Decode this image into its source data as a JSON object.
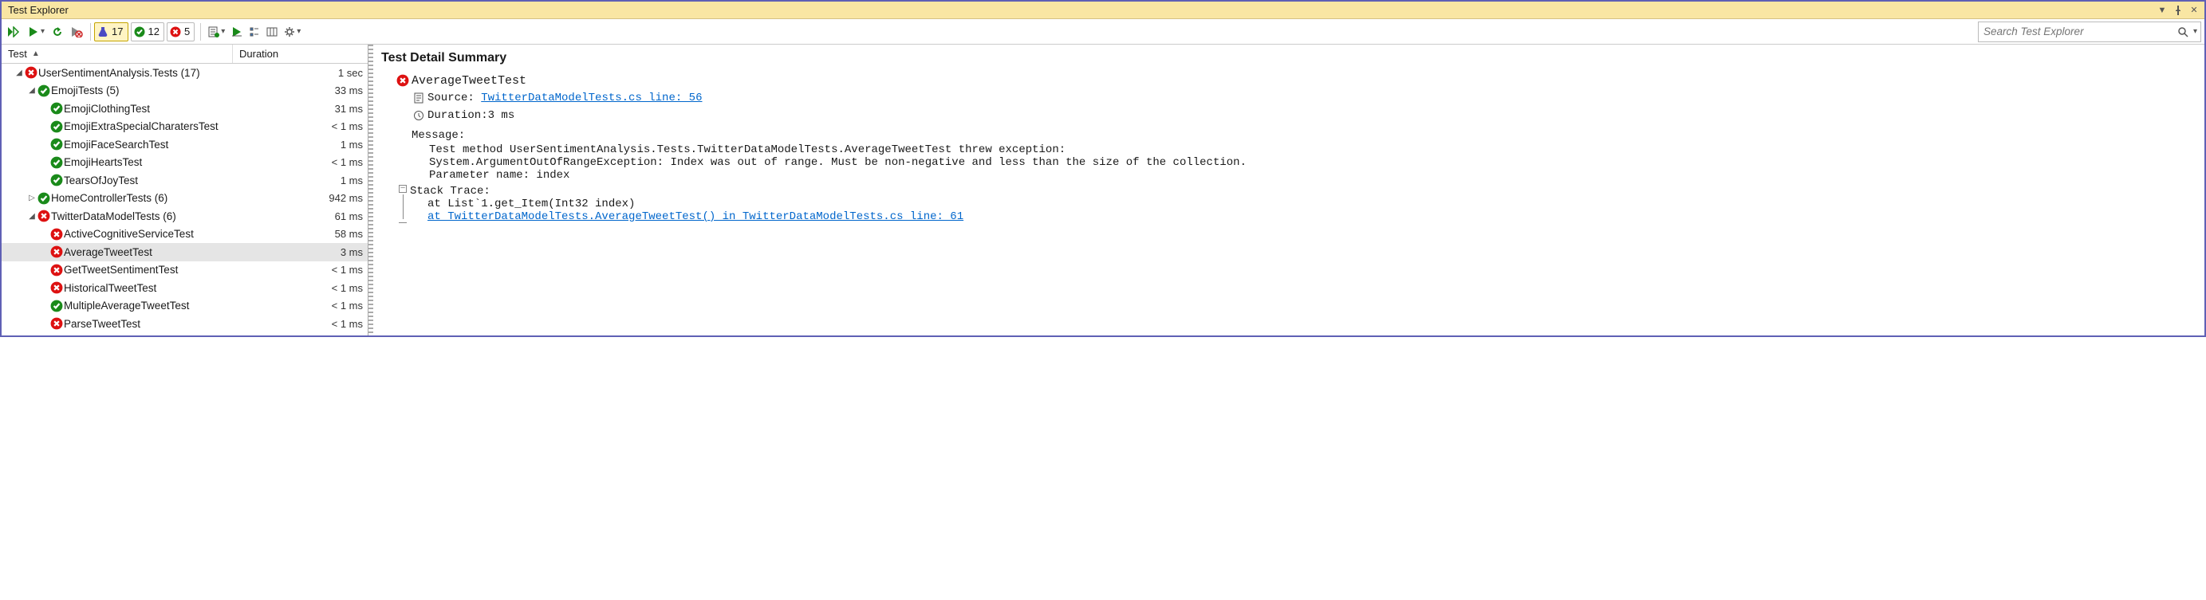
{
  "title": "Test Explorer",
  "search_placeholder": "Search Test Explorer",
  "filters": {
    "total": 17,
    "passed": 12,
    "failed": 5
  },
  "columns": {
    "test": "Test",
    "duration": "Duration"
  },
  "tree": [
    {
      "indent": 0,
      "glyph": "▲",
      "status": "fail",
      "name": "UserSentimentAnalysis.Tests  (17)",
      "duration": "1 sec"
    },
    {
      "indent": 1,
      "glyph": "▲",
      "status": "pass",
      "name": "EmojiTests  (5)",
      "duration": "33 ms"
    },
    {
      "indent": 2,
      "glyph": "",
      "status": "pass",
      "name": "EmojiClothingTest",
      "duration": "31 ms"
    },
    {
      "indent": 2,
      "glyph": "",
      "status": "pass",
      "name": "EmojiExtraSpecialCharatersTest",
      "duration": "< 1 ms"
    },
    {
      "indent": 2,
      "glyph": "",
      "status": "pass",
      "name": "EmojiFaceSearchTest",
      "duration": "1 ms"
    },
    {
      "indent": 2,
      "glyph": "",
      "status": "pass",
      "name": "EmojiHeartsTest",
      "duration": "< 1 ms"
    },
    {
      "indent": 2,
      "glyph": "",
      "status": "pass",
      "name": "TearsOfJoyTest",
      "duration": "1 ms"
    },
    {
      "indent": 1,
      "glyph": "▷",
      "status": "pass",
      "name": "HomeControllerTests  (6)",
      "duration": "942 ms"
    },
    {
      "indent": 1,
      "glyph": "▲",
      "status": "fail",
      "name": "TwitterDataModelTests  (6)",
      "duration": "61 ms"
    },
    {
      "indent": 2,
      "glyph": "",
      "status": "fail",
      "name": "ActiveCognitiveServiceTest",
      "duration": "58 ms"
    },
    {
      "indent": 2,
      "glyph": "",
      "status": "fail",
      "name": "AverageTweetTest",
      "duration": "3 ms",
      "selected": true
    },
    {
      "indent": 2,
      "glyph": "",
      "status": "fail",
      "name": "GetTweetSentimentTest",
      "duration": "< 1 ms"
    },
    {
      "indent": 2,
      "glyph": "",
      "status": "fail",
      "name": "HistoricalTweetTest",
      "duration": "< 1 ms"
    },
    {
      "indent": 2,
      "glyph": "",
      "status": "pass",
      "name": "MultipleAverageTweetTest",
      "duration": "< 1 ms"
    },
    {
      "indent": 2,
      "glyph": "",
      "status": "fail",
      "name": "ParseTweetTest",
      "duration": "< 1 ms"
    }
  ],
  "detail": {
    "heading": "Test Detail Summary",
    "test_name": "AverageTweetTest",
    "source_label": "Source:",
    "source_link": "TwitterDataModelTests.cs line: 56",
    "duration_label": "Duration:",
    "duration_value": " 3 ms",
    "message_label": "Message:",
    "message_lines": [
      "Test method UserSentimentAnalysis.Tests.TwitterDataModelTests.AverageTweetTest threw exception: ",
      "System.ArgumentOutOfRangeException: Index was out of range. Must be non-negative and less than the size of the collection.",
      "Parameter name: index"
    ],
    "stack_label": "Stack Trace:",
    "stack_lines": [
      {
        "text": "at List`1.get_Item(Int32 index)",
        "link": false
      },
      {
        "text": "at TwitterDataModelTests.AverageTweetTest() in TwitterDataModelTests.cs line: 61",
        "link": true
      }
    ]
  }
}
